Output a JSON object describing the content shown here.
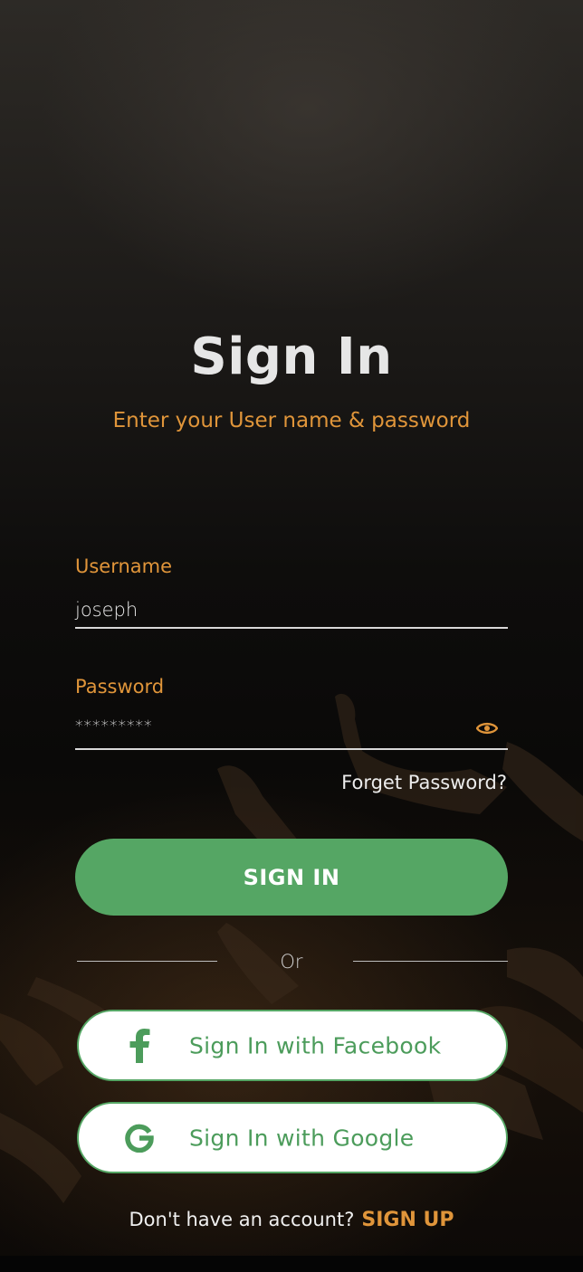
{
  "screen": {
    "title": "Sign In",
    "subtitle": "Enter your User name & password"
  },
  "form": {
    "username": {
      "label": "Username",
      "value": "joseph"
    },
    "password": {
      "label": "Password",
      "value": "*********",
      "toggle_icon": "eye-icon"
    },
    "forgot_label": "Forget Password?",
    "submit_label": "SIGN IN"
  },
  "divider": {
    "label": "Or"
  },
  "social": {
    "facebook": {
      "label": "Sign In with Facebook",
      "icon": "facebook-icon"
    },
    "google": {
      "label": "Sign In with Google",
      "icon": "google-icon"
    }
  },
  "footer": {
    "prompt": "Don't have an account?",
    "link_label": "SIGN UP"
  },
  "colors": {
    "accent": "#e0953a",
    "primary_green": "#55a664",
    "background": "#0b0b0b"
  }
}
